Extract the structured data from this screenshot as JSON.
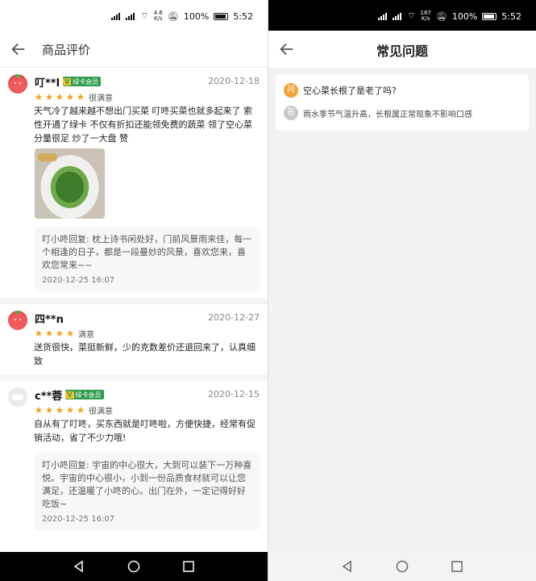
{
  "left": {
    "statusbar": {
      "net_speed": "4.6",
      "net_unit": "K/s",
      "battery": "100%",
      "time": "5:52"
    },
    "header": {
      "title": "商品评价"
    },
    "reviews": [
      {
        "user": "叮**l",
        "badge": "绿卡会员",
        "date": "2020-12-18",
        "stars": 5,
        "rating_label": "很满意",
        "text": "天气冷了越来越不想出门买菜 叮咚买菜也就多起来了 索性开通了绿卡 不仅有折扣还能领免费的蔬菜 领了空心菜 分量很足 炒了一大盘 赞",
        "reply": "叮小咚回复: 枕上诗书闲处好，门前风景雨来佳，每一个相逢的日子，都是一段曼妙的风景，喜欢您来，喜欢您常来~~",
        "reply_date": "2020-12-25 16:07"
      },
      {
        "user": "四**n",
        "date": "2020-12-27",
        "stars": 4,
        "rating_label": "满意",
        "text": "送货很快，菜挺新鲜，少的克数差价还退回来了，认真细致"
      },
      {
        "user": "c**蓉",
        "badge": "绿卡会员",
        "date": "2020-12-15",
        "stars": 5,
        "rating_label": "很满意",
        "text": "自从有了叮咚，买东西就是叮咚啦，方便快捷，经常有促销活动，省了不少力哦!",
        "reply": "叮小咚回复: 宇宙的中心很大，大到可以装下一万种喜悦。宇宙的中心很小，小到一份品质食材就可以让您满足，还温暖了小咚的心。出门在外，一定记得好好吃饭~",
        "reply_date": "2020-12-25 16:07"
      }
    ]
  },
  "right": {
    "statusbar": {
      "net_speed": "187",
      "net_unit": "K/s",
      "battery": "100%",
      "time": "5:52"
    },
    "header": {
      "title": "常见问题"
    },
    "faq": {
      "q_badge": "问",
      "a_badge": "答",
      "question": "空心菜长根了是老了吗?",
      "answer": "雨水季节气温升高，长根属正常现象不影响口感"
    }
  },
  "colors": {
    "star": "#f5a623",
    "badge_green": "#2e9d4b",
    "question_orange": "#f0a23b"
  }
}
